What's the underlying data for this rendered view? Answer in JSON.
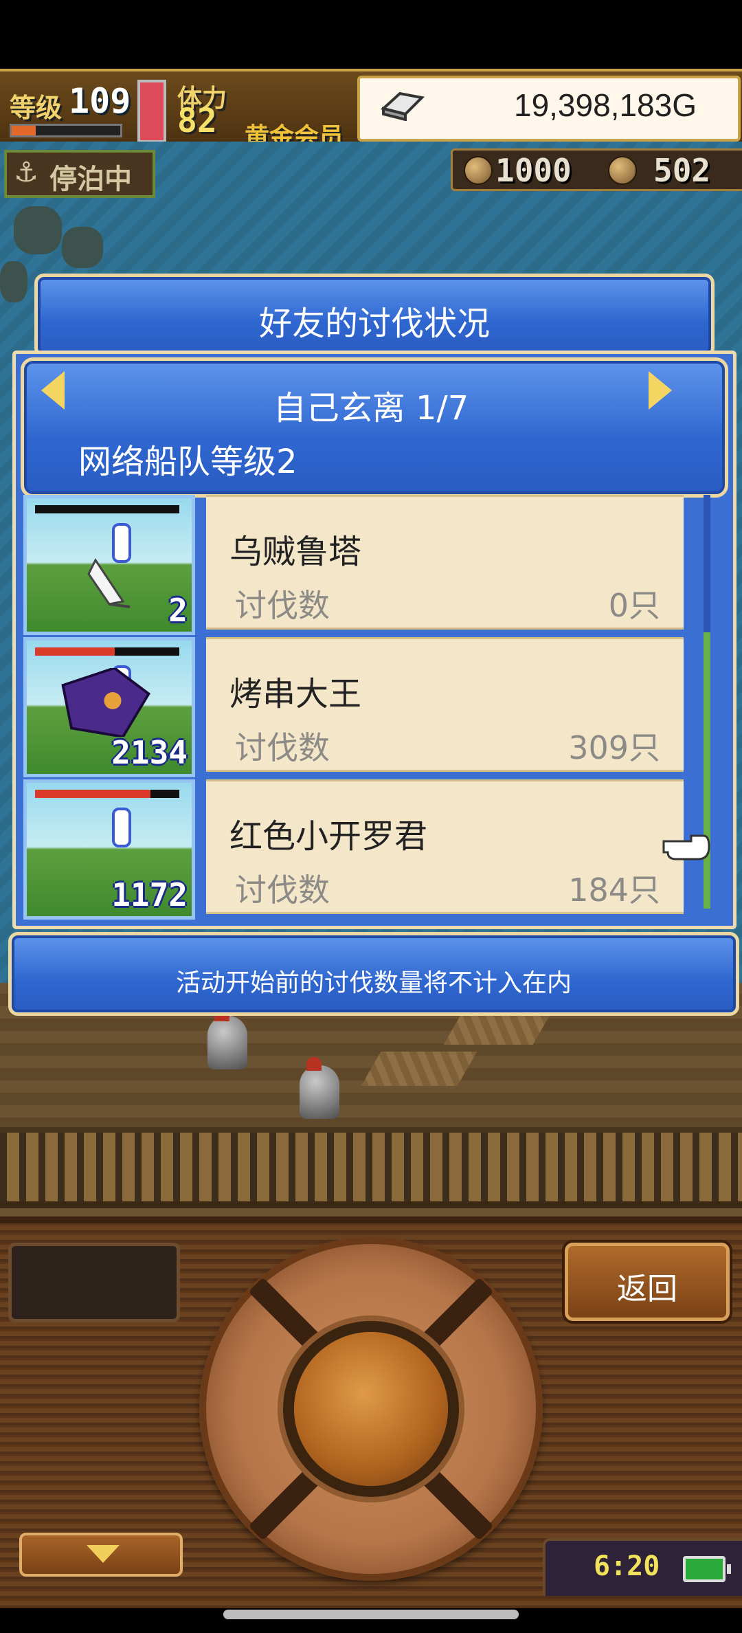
{
  "status": {
    "level_label": "等级",
    "level_value": "109",
    "stamina_label": "体力",
    "stamina_value": "82",
    "membership": "黄金会员",
    "gold": "19,398,183G",
    "exp_fraction": 0.22
  },
  "map": {
    "docked_label": "停泊中",
    "resource_1": "1000",
    "resource_2": "502"
  },
  "dialog": {
    "title": "好友的讨伐状况",
    "page_label": "自己玄离 1/7",
    "fleet_level": "网络船队等级2",
    "notice": "活动开始前的讨伐数量将不计入在内",
    "rows": [
      {
        "name": "乌贼鲁塔",
        "count_label": "讨伐数",
        "count": "0只",
        "thumb_num": "2",
        "hp_fraction": 0.0
      },
      {
        "name": "烤串大王",
        "count_label": "讨伐数",
        "count": "309只",
        "thumb_num": "2134",
        "hp_fraction": 0.55
      },
      {
        "name": "红色小开罗君",
        "count_label": "讨伐数",
        "count": "184只",
        "thumb_num": "1172",
        "hp_fraction": 0.8
      }
    ]
  },
  "controls": {
    "back_label": "返回",
    "clock": "6:20"
  },
  "colors": {
    "panel_blue": "#2e66cf",
    "card_bg": "#f4e6c8",
    "accent_gold": "#f4d561"
  }
}
